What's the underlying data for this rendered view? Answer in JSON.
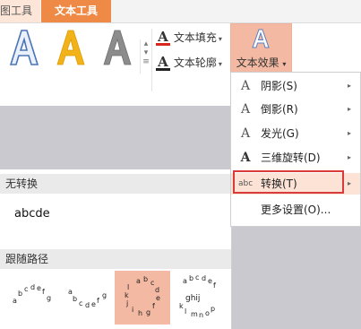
{
  "tabs": {
    "picture_tools": "图工具",
    "text_tools": "文本工具"
  },
  "ribbon": {
    "text_fill": "文本填充",
    "text_outline": "文本轮廓",
    "text_effects": "文本效果",
    "art_glyph": "A"
  },
  "menu": {
    "items": [
      {
        "label": "阴影(S)",
        "icon": "shadow-icon"
      },
      {
        "label": "倒影(R)",
        "icon": "reflection-icon"
      },
      {
        "label": "发光(G)",
        "icon": "glow-icon"
      },
      {
        "label": "三维旋转(D)",
        "icon": "3d-rotation-icon"
      },
      {
        "label": "转换(T)",
        "icon": "transform-icon"
      }
    ],
    "more": "更多设置(O)..."
  },
  "panel": {
    "no_transform_header": "无转换",
    "sample_text": "abcde",
    "follow_path_header": "跟随路径"
  },
  "colors": {
    "accent": "#ee8a46",
    "selected": "#f3b9a2",
    "highlight_border": "#d93a3a"
  }
}
